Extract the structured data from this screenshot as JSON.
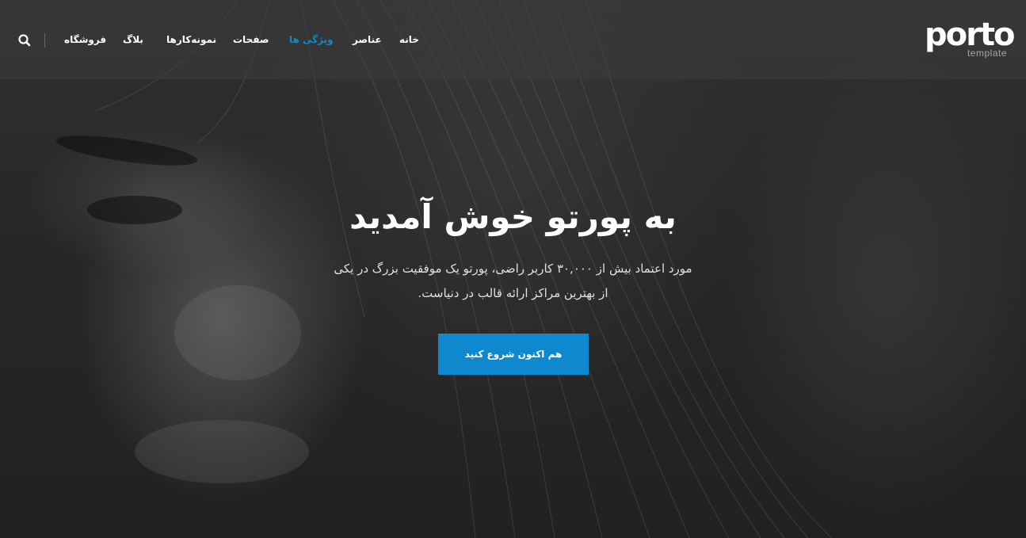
{
  "brand": {
    "logo_text": "porto",
    "logo_subtext": "template"
  },
  "nav": {
    "items": [
      {
        "label": "خانه",
        "active": false
      },
      {
        "label": "عناصر",
        "active": false
      },
      {
        "label": "ویژگی ها",
        "active": true
      },
      {
        "label": "صفحات",
        "active": false
      },
      {
        "label": "نمونه‌کارها",
        "active": false
      },
      {
        "label": "بلاگ",
        "active": false
      },
      {
        "label": "فروشگاه",
        "active": false
      }
    ],
    "search_icon": "search-icon"
  },
  "hero": {
    "title": "به پورتو خوش آمدید",
    "subtitle_line1": "مورد اعتماد بیش از ۳۰,۰۰۰ کاربر راضی، پورتو یک موفقیت بزرگ در یکی",
    "subtitle_line2": "از بهترین مراکز ارائه قالب در دنیاست.",
    "cta_label": "هم اکنون شروع کنید"
  },
  "colors": {
    "accent": "#0e88cf",
    "header_bg": "rgba(60,60,60,0.55)",
    "text": "#ffffff"
  }
}
